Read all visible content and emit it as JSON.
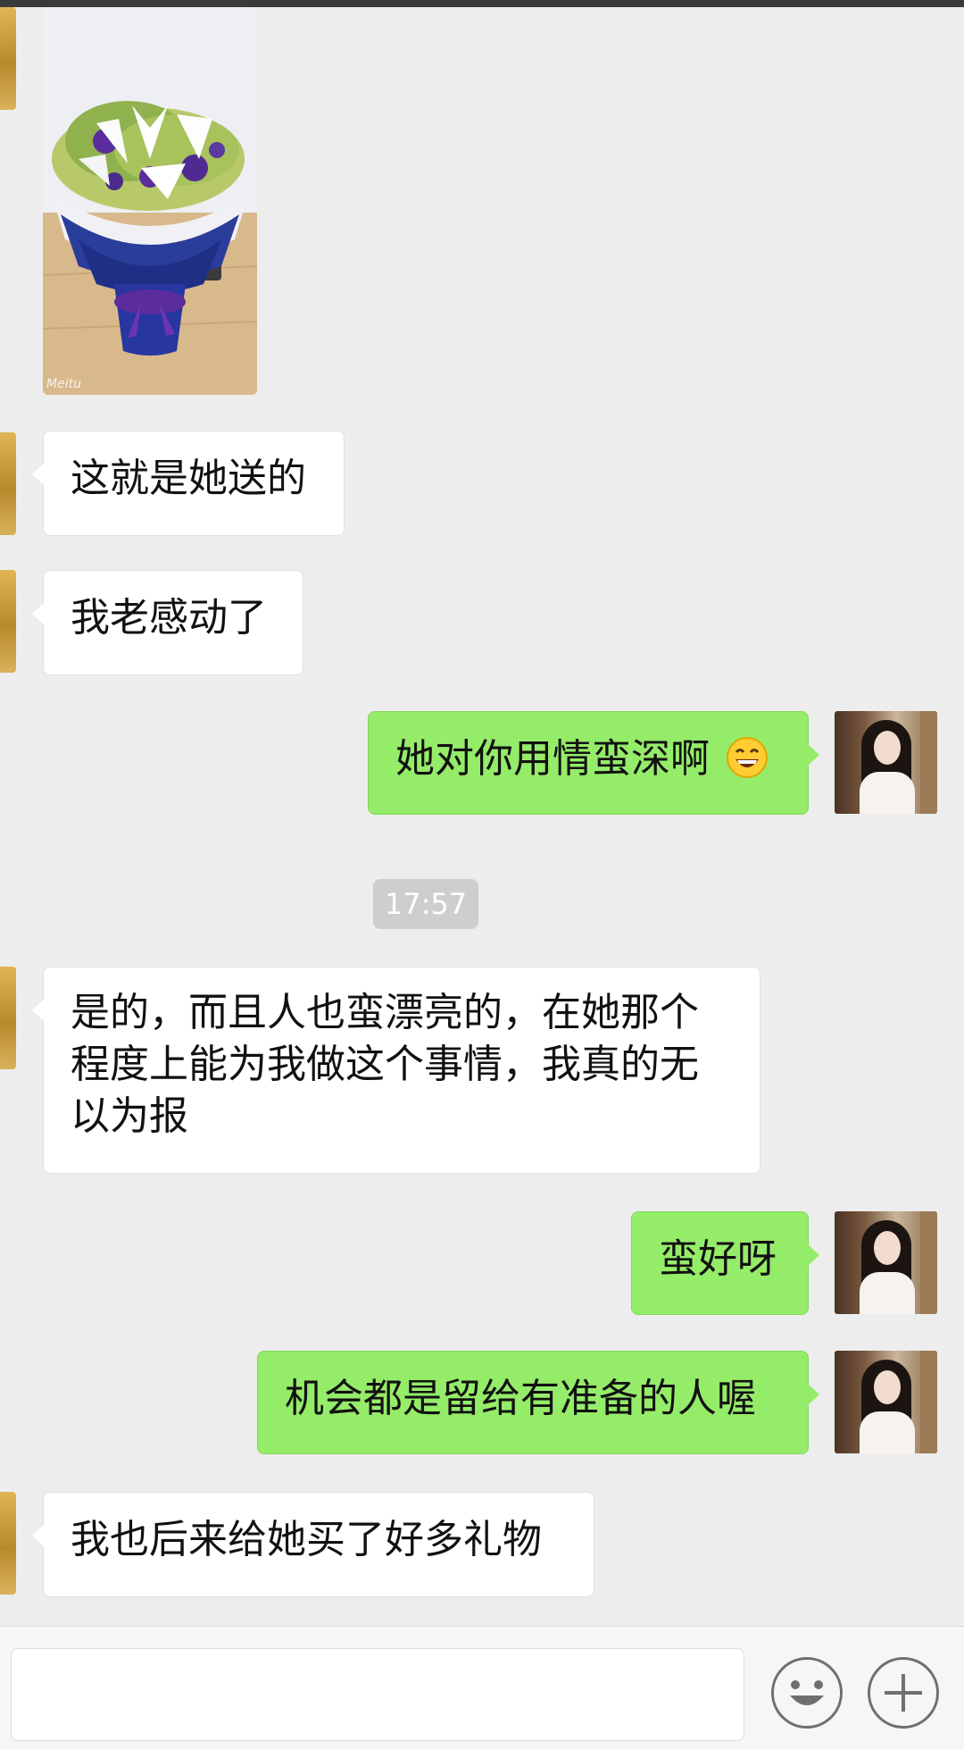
{
  "messages": [
    {
      "side": "left",
      "type": "image"
    },
    {
      "side": "left",
      "type": "text",
      "text": "这就是她送的"
    },
    {
      "side": "left",
      "type": "text",
      "text": "我老感动了"
    },
    {
      "side": "right",
      "type": "text",
      "text": "她对你用情蛮深啊",
      "emoji": "grinning-face-icon"
    },
    {
      "type": "timestamp",
      "text": "17:57"
    },
    {
      "side": "left",
      "type": "text",
      "lines": [
        "是的，而且人也蛮漂亮的，在她那个",
        "程度上能为我做这个事情，我真的无",
        "以为报"
      ]
    },
    {
      "side": "right",
      "type": "text",
      "text": "蛮好呀"
    },
    {
      "side": "right",
      "type": "text",
      "text": "机会都是留给有准备的人喔"
    },
    {
      "side": "left",
      "type": "text",
      "text": "我也后来给她买了好多礼物"
    }
  ],
  "photo": {
    "watermark": "Meitu"
  },
  "input_bar": {
    "value": "",
    "emoji_button": "smiley-icon",
    "plus_button": "plus-icon"
  },
  "colors": {
    "background": "#ededed",
    "sent_bubble": "#95ec69",
    "received_bubble": "#ffffff"
  }
}
